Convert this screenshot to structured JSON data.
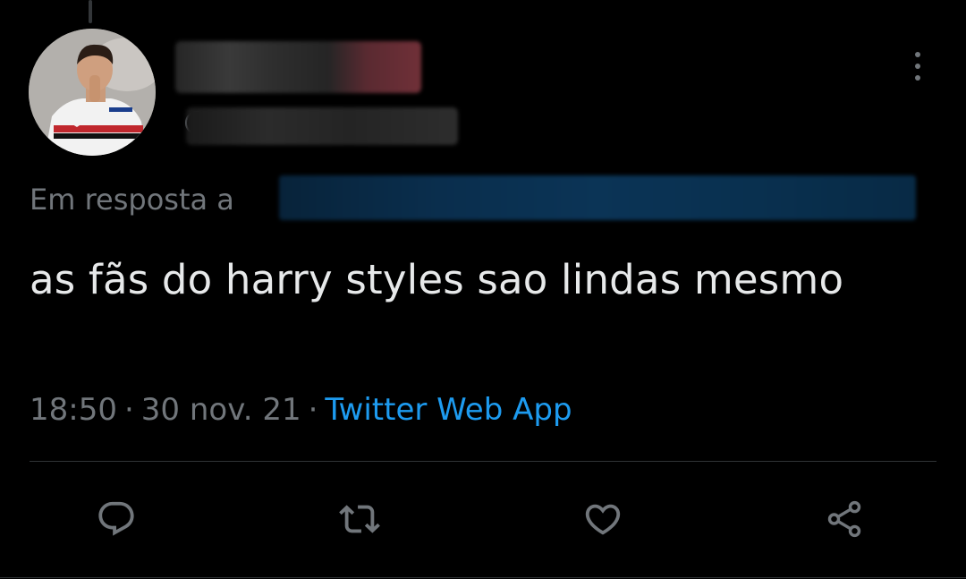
{
  "tweet": {
    "reply_prefix": "Em resposta a",
    "text": "as fãs do harry styles sao lindas mesmo",
    "time": "18:50",
    "date": "30 nov. 21",
    "separator": "·",
    "source": "Twitter Web App",
    "handle_symbol": "@"
  },
  "icons": {
    "more": "more-icon",
    "reply": "reply-icon",
    "retweet": "retweet-icon",
    "like": "like-icon",
    "share": "share-icon"
  },
  "colors": {
    "background": "#000000",
    "text": "#e7e9ea",
    "secondary": "#71767b",
    "link": "#1d9bf0",
    "divider": "#2f3336"
  }
}
